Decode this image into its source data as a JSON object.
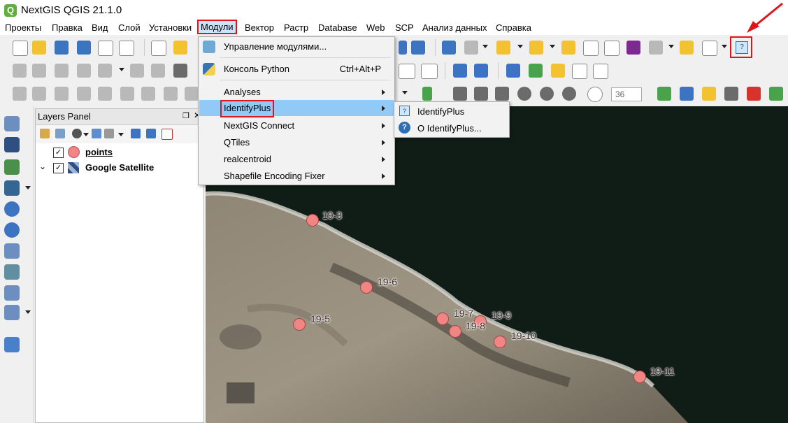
{
  "window": {
    "title": "NextGIS QGIS 21.1.0"
  },
  "menubar": {
    "items": [
      "Проекты",
      "Правка",
      "Вид",
      "Слой",
      "Установки",
      "Модули",
      "Вектор",
      "Растр",
      "Database",
      "Web",
      "SCP",
      "Анализ данных",
      "Справка"
    ],
    "active": "Модули"
  },
  "context_menu": {
    "items": [
      {
        "label": "Управление модулями...",
        "icon": "puzzle-icon"
      },
      {
        "label": "Консоль Python",
        "shortcut": "Ctrl+Alt+P",
        "icon": "python-icon"
      },
      {
        "label": "Analyses",
        "has_submenu": true
      },
      {
        "label": "IdentifyPlus",
        "has_submenu": true,
        "highlighted": true
      },
      {
        "label": "NextGIS Connect",
        "has_submenu": true
      },
      {
        "label": "QTiles",
        "has_submenu": true
      },
      {
        "label": "realcentroid",
        "has_submenu": true
      },
      {
        "label": "Shapefile Encoding Fixer",
        "has_submenu": true
      }
    ]
  },
  "submenu": {
    "items": [
      {
        "label": "IdentifyPlus",
        "icon": "identify-plus-icon"
      },
      {
        "label": "О IdentifyPlus...",
        "icon": "help-circle-icon"
      }
    ]
  },
  "toolbar": {
    "scale_value": "36"
  },
  "layers_panel": {
    "title": "Layers Panel",
    "layers": [
      {
        "name": "points",
        "checked": true,
        "icon": "point-symbol-icon"
      },
      {
        "name": "Google Satellite",
        "checked": true,
        "icon": "raster-icon"
      }
    ]
  },
  "map": {
    "points": [
      "19-3",
      "19-6",
      "19-5",
      "19-7",
      "19-9",
      "19-8",
      "19-10",
      "19-11"
    ]
  },
  "colors": {
    "highlight": "#cce4f7",
    "annotation": "#e0151b",
    "point_fill": "#f08585"
  }
}
